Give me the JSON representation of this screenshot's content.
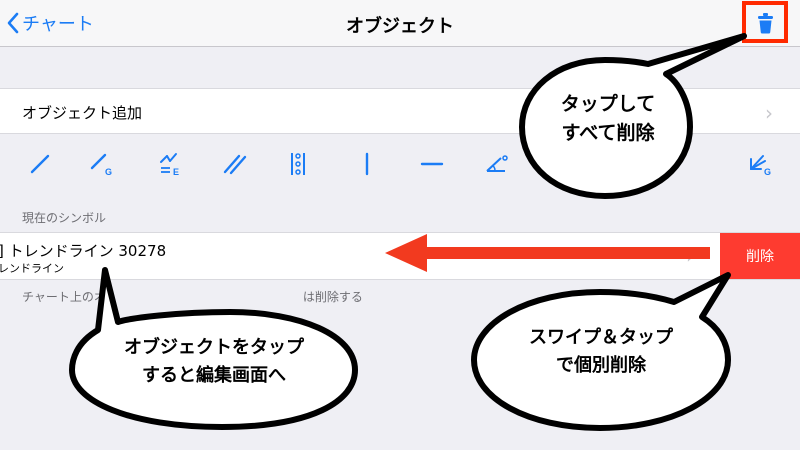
{
  "nav": {
    "back_label": "チャート",
    "title": "オブジェクト"
  },
  "add_row": {
    "label": "オブジェクト追加"
  },
  "drawing_tools": [
    "line-tool-icon",
    "line-g-tool-icon",
    "fibonacci-extension-tool-icon",
    "parallel-lines-tool-icon",
    "vertical-fibonacci-tool-icon",
    "vertical-line-tool-icon",
    "horizontal-line-tool-icon",
    "angle-tool-icon",
    "gann-fan-tool-icon"
  ],
  "section_header": "現在のシンボル",
  "symbol_row": {
    "title": "] トレンドライン 30278",
    "subtitle": "レンドライン",
    "delete_label": "削除"
  },
  "footer_note": "チャート上のオ",
  "footer_note_tail": "は削除する",
  "callouts": {
    "delete_all": "タップして\nすべて削除",
    "tap_object": "オブジェクトをタップ\nすると編集画面へ",
    "swipe_delete": "スワイプ＆タップ\nで個別削除"
  },
  "colors": {
    "accent": "#1b7cf5",
    "delete": "#fe3b30",
    "highlight": "#ff2a00",
    "arrow": "#f23a1f"
  }
}
